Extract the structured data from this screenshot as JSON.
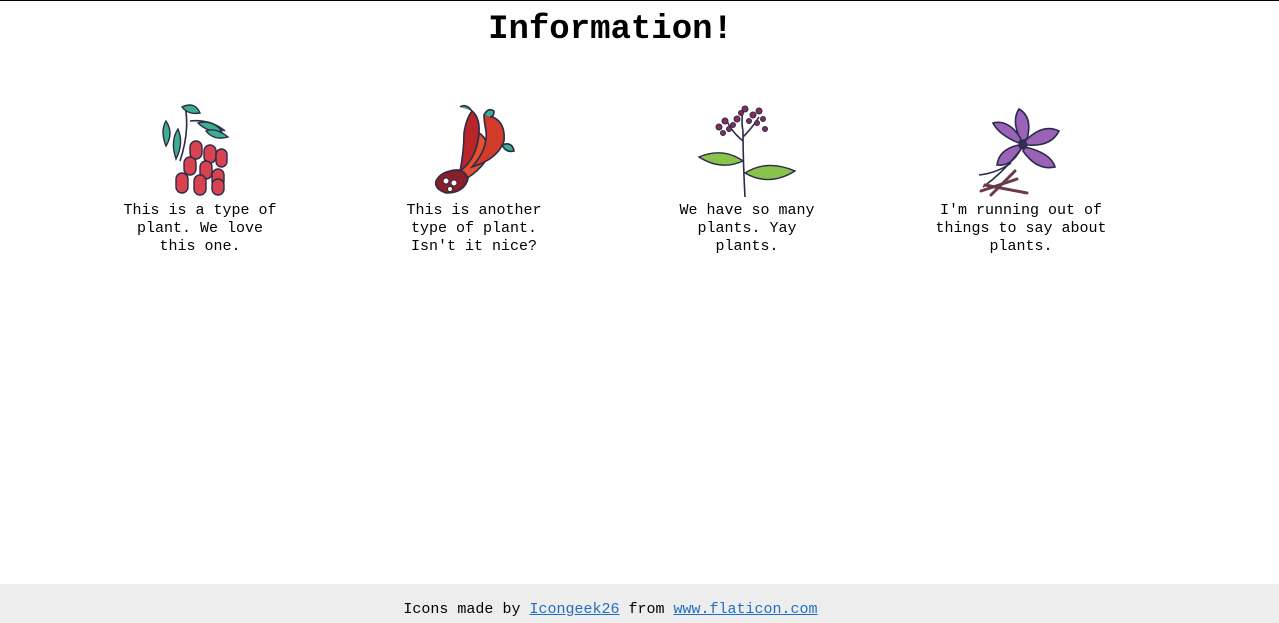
{
  "header": {
    "title": "Information!"
  },
  "cards": [
    {
      "icon": "goji-berry-plant-icon",
      "caption": "This is a type of plant. We love this one."
    },
    {
      "icon": "chili-pepper-icon",
      "caption": "This is another type of plant. Isn't it nice?"
    },
    {
      "icon": "flowering-herb-icon",
      "caption": "We have so many plants. Yay plants."
    },
    {
      "icon": "purple-flower-icon",
      "caption": "I'm running out of things to say about plants."
    }
  ],
  "footer": {
    "prefix": "Icons made by",
    "author_link": "Icongeek26",
    "middle": "from",
    "site_link": "www.flaticon.com"
  },
  "colors": {
    "footer_bg": "#ededed",
    "link": "#1e6fc4"
  }
}
